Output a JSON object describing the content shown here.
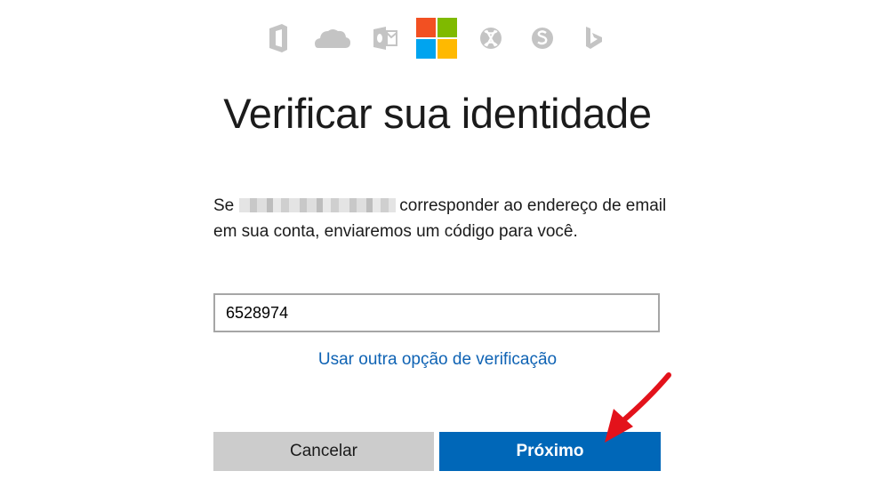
{
  "header": {
    "icons": [
      "office-icon",
      "onedrive-icon",
      "outlook-icon",
      "microsoft-logo",
      "xbox-icon",
      "skype-icon",
      "bing-icon"
    ],
    "logo_colors": [
      "#f25022",
      "#7fba00",
      "#00a4ef",
      "#ffb900"
    ],
    "icon_gray": "#c4c4c4"
  },
  "title": "Verificar sua identidade",
  "description": {
    "prefix": "Se",
    "suffix": "corresponder ao endereço de email em sua conta, enviaremos um código para você."
  },
  "code_input": {
    "value": "6528974"
  },
  "alt_link": "Usar outra opção de verificação",
  "buttons": {
    "cancel": "Cancelar",
    "next": "Próximo"
  },
  "colors": {
    "accent": "#0067b8",
    "link": "#0f63b4",
    "annotation_arrow": "#e3121b"
  }
}
